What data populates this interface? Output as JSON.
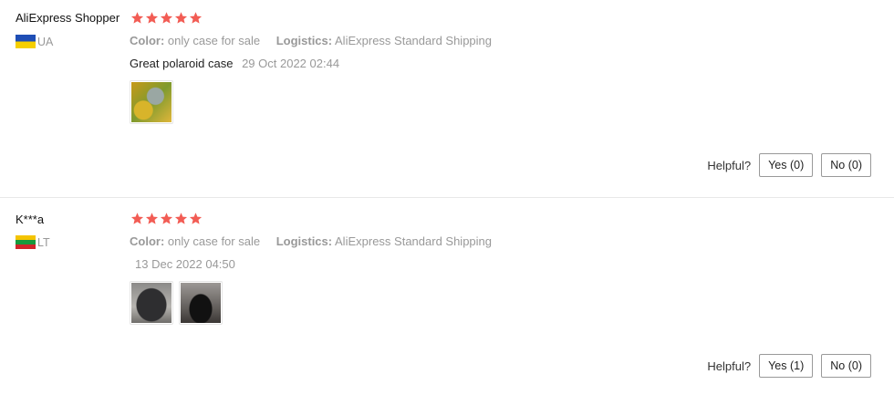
{
  "reviews": [
    {
      "user": "AliExpress Shopper",
      "country": "UA",
      "stars": 5,
      "color_label": "Color:",
      "color_value": "only case for sale",
      "logistics_label": "Logistics:",
      "logistics_value": "AliExpress Standard Shipping",
      "text": "Great polaroid case",
      "date": "29 Oct 2022 02:44",
      "helpful_label": "Helpful?",
      "yes_label": "Yes (0)",
      "no_label": "No (0)"
    },
    {
      "user": "K***a",
      "country": "LT",
      "stars": 5,
      "color_label": "Color:",
      "color_value": "only case for sale",
      "logistics_label": "Logistics:",
      "logistics_value": "AliExpress Standard Shipping",
      "text": "",
      "date": "13 Dec 2022 04:50",
      "helpful_label": "Helpful?",
      "yes_label": "Yes (1)",
      "no_label": "No (0)"
    }
  ],
  "colors": {
    "star": "#f25c54",
    "meta": "#999999"
  }
}
